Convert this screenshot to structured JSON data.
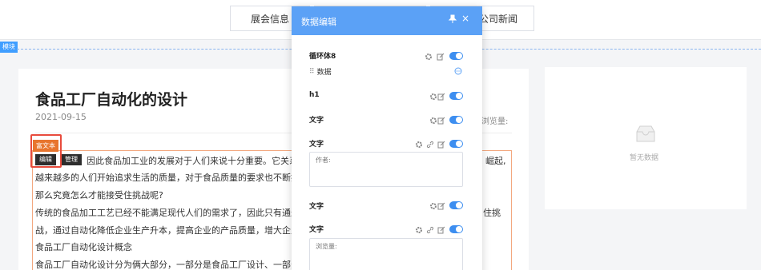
{
  "nav": {
    "tabs": [
      {
        "label": "展会信息"
      },
      {
        "label": ""
      },
      {
        "label": "公司新闻"
      }
    ]
  },
  "module_tag": "模块",
  "article": {
    "title": "食品工厂自动化的设计",
    "date": "2021-09-15",
    "views_label": "浏览量:",
    "richtext_label": "富文本",
    "edit_btn": "编辑",
    "manage_btn": "管理",
    "lines": [
      "因此食品加工业的发展对于人们来说十分重要。它关系",
      "崛起,",
      "越来越多的人们开始追求生活的质量，对于食品质量的要求也不断提",
      "那么究竟怎么才能接受住挑战呢?",
      "传统的食品加工工艺已经不能满足现代人们的需求了，因此只有通过",
      "住挑",
      "战，通过自动化降低企业生产升本，提高企业的产品质量，增大企业",
      "食品工厂自动化设计概念",
      "食品工厂自动化设计分为俩大部分，一部分是食品工厂设计、一部分"
    ]
  },
  "sidebar_empty": "暂无数据",
  "panel": {
    "title": "数据编辑",
    "close": "×",
    "rows": [
      {
        "label": "循环体8",
        "sub": "数据"
      },
      {
        "label": "h1"
      },
      {
        "label": "文字"
      },
      {
        "label": "文字",
        "placeholder": "作者:"
      },
      {
        "label": "文字"
      },
      {
        "label": "文字",
        "placeholder": "浏览量:"
      }
    ]
  },
  "colors": {
    "accent": "#409eff",
    "panel_header": "#5ba1f6",
    "toggle": "#3d8ef0",
    "richtext_tag": "#e8752e",
    "highlight": "#e84b3c"
  }
}
